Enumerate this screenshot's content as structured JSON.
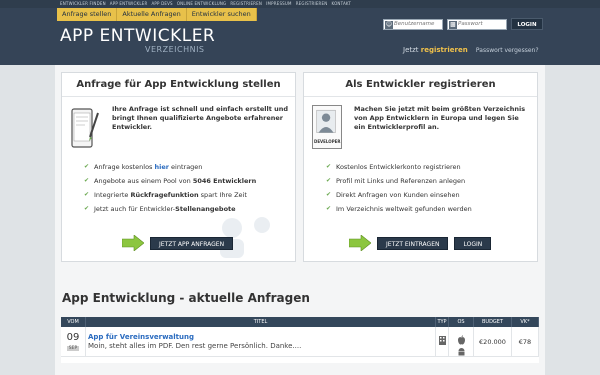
{
  "topbar": {
    "links": [
      "ENTWICKLER FINDEN",
      "APP ENTWICKLER",
      "APP DEVS",
      "ONLINE ENTWICKLUNG",
      "REGISTRIEREN",
      "IMPRESSUM",
      "REGISTRIEREN",
      "KONTAKT"
    ]
  },
  "subnav": {
    "items": [
      "Anfrage stellen",
      "Aktuelle Anfragen",
      "Entwickler suchen"
    ]
  },
  "logo": {
    "main": "APP ENTWICKLER",
    "sub": "VERZEICHNIS"
  },
  "login": {
    "username_placeholder": "Benutzername",
    "password_placeholder": "Passwort",
    "button": "LOGIN",
    "now": "Jetzt",
    "register": "registrieren",
    "forgot": "Passwort vergessen?"
  },
  "left_panel": {
    "title": "Anfrage für App Entwicklung stellen",
    "intro": "Ihre Anfrage ist schnell und einfach erstellt und bringt Ihnen qualifizierte Angebote erfahrener Entwickler.",
    "b1_pre": "Anfrage kostenlos ",
    "b1_hl": "hier",
    "b1_post": " eintragen",
    "b2_pre": "Angebote aus einem Pool von ",
    "b2_bold": "5046 Entwicklern",
    "b3_pre": "Integrierte ",
    "b3_bold": "Rückfragefunktion",
    "b3_post": " spart Ihre Zeit",
    "b4_pre": "Jetzt auch für Entwickler-",
    "b4_bold": "Stellenangebote",
    "button": "JETZT APP ANFRAGEN"
  },
  "right_panel": {
    "title": "Als Entwickler registrieren",
    "intro": "Machen Sie jetzt mit beim größten Verzeichnis von App Entwicklern in Europa und legen Sie ein Entwicklerprofil an.",
    "badge": "DEVELOPER",
    "bullets": [
      "Kostenlos Entwicklerkonto registrieren",
      "Profil mit Links und Referenzen anlegen",
      "Direkt Anfragen von Kunden einsehen",
      "Im Verzeichnis weltweit gefunden werden"
    ],
    "button_primary": "JETZT EINTRAGEN",
    "button_secondary": "LOGIN"
  },
  "requests": {
    "title": "App Entwicklung - aktuelle Anfragen",
    "columns": [
      "VOM",
      "TITEL",
      "TYP",
      "OS",
      "BUDGET",
      "VK*"
    ],
    "rows": [
      {
        "day": "09",
        "month": "SEP",
        "title": "App für Vereinsverwaltung",
        "desc": "Moin, steht alles im PDF. Den rest gerne Persönlich. Danke....",
        "budget": "€20.000",
        "vk": "€78"
      }
    ]
  }
}
